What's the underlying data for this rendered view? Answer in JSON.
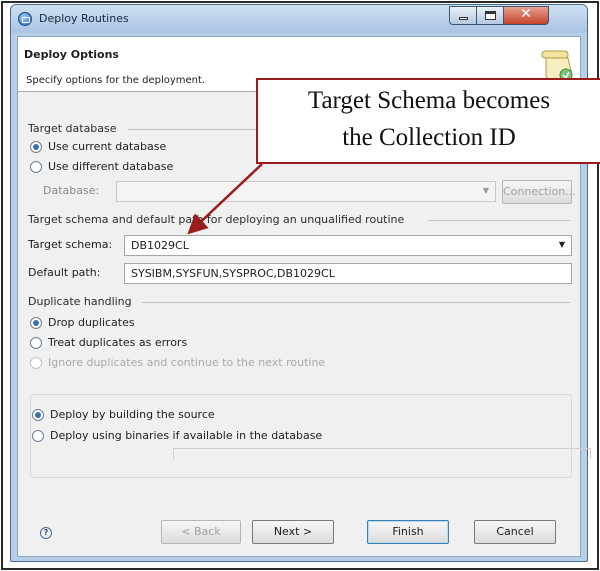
{
  "window": {
    "title": "Deploy Routines"
  },
  "banner": {
    "title": "Deploy Options",
    "description": "Specify options for the deployment."
  },
  "target_database": {
    "label": "Target database",
    "use_current": "Use current database",
    "use_different": "Use different database",
    "database_label": "Database:",
    "database_value": "",
    "connection_button": "Connection..."
  },
  "schema_section": {
    "label": "Target schema and default path for deploying an unqualified routine",
    "target_schema_label": "Target schema:",
    "target_schema_value": "DB1029CL",
    "default_path_label": "Default path:",
    "default_path_value": "SYSIBM,SYSFUN,SYSPROC,DB1029CL"
  },
  "duplicate_handling": {
    "label": "Duplicate handling",
    "options": [
      {
        "label": "Drop duplicates",
        "checked": true,
        "enabled": true
      },
      {
        "label": "Treat duplicates as errors",
        "checked": false,
        "enabled": true
      },
      {
        "label": "Ignore duplicates and continue to the next routine",
        "checked": false,
        "enabled": false
      }
    ]
  },
  "deploy_method": {
    "options": [
      {
        "label": "Deploy by building the source",
        "checked": true
      },
      {
        "label": "Deploy using binaries if available in the database",
        "checked": false
      }
    ]
  },
  "buttons": {
    "back": "< Back",
    "next": "Next >",
    "finish": "Finish",
    "cancel": "Cancel"
  },
  "annotation": {
    "text": "Target Schema becomes\nthe Collection ID",
    "color": "#9b1c1c"
  },
  "colors": {
    "accent": "#3a6fb0",
    "title_bar": "#a9c4e2"
  },
  "icons": {
    "app": "app-icon",
    "banner": "scroll-icon",
    "help": "help-icon"
  }
}
